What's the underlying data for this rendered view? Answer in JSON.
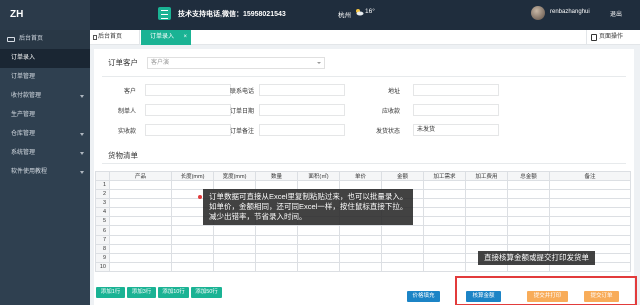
{
  "header": {
    "logo": "ZH",
    "contact": "技术支持电话,微信：15958021543",
    "city": "杭州",
    "weather_icon": "sun-cloud-icon",
    "temperature": "16°",
    "username": "renbazhanghui",
    "logout": "退出"
  },
  "sidebar": {
    "items": [
      {
        "label": "后台首页"
      },
      {
        "label": "订单录入"
      },
      {
        "label": "订单管理"
      },
      {
        "label": "收付款管理"
      },
      {
        "label": "生产管理"
      },
      {
        "label": "仓库管理"
      },
      {
        "label": "系统管理"
      },
      {
        "label": "软件使用教程"
      }
    ]
  },
  "tabs": {
    "home": "后台首页",
    "order_entry": "订单录入",
    "close": "×",
    "page_ops": "页面操作"
  },
  "form": {
    "title": "订单客户",
    "customer_select_placeholder": "客户演",
    "labels": {
      "customer": "客户",
      "phone": "联系电话",
      "address": "地址",
      "creator": "制单人",
      "order_date": "订单日期",
      "receivable": "应收款",
      "received": "实收款",
      "order_note": "订单备注",
      "ship_status": "发货状态"
    },
    "ship_status_value": "未发货"
  },
  "goods": {
    "title": "货物清单",
    "columns": [
      "",
      "产品",
      "长度(mm)",
      "宽度(mm)",
      "数量",
      "面积(㎡)",
      "单价",
      "金额",
      "加工需求",
      "加工费用",
      "总金额",
      "备注"
    ],
    "row_numbers": [
      "1",
      "2",
      "3",
      "4",
      "5",
      "6",
      "7",
      "8",
      "9",
      "10"
    ]
  },
  "buttons": {
    "add1": "添加1行",
    "add3": "添加3行",
    "add10": "添加10行",
    "add50": "添加50行",
    "price_fill": "价格填充",
    "check_amount": "核算金额",
    "submit_print": "提交并打印",
    "submit_order": "提交订单"
  },
  "tooltips": {
    "left": "订单数据可直接从Excel里复制粘贴过来，也可以批量录入。\n如单价，金额相同，还可同Excel一样，按住鼠标直接下拉。\n减少出错率，节省录入时间。",
    "right": "直接核算金额或提交打印发货单"
  },
  "colors": {
    "topbar": "#1f2d3d",
    "sidebar": "#2f4050",
    "accent": "#1ab394",
    "blue": "#1c84c6",
    "yellow": "#f8ac59",
    "highlight": "#e23b3b"
  }
}
